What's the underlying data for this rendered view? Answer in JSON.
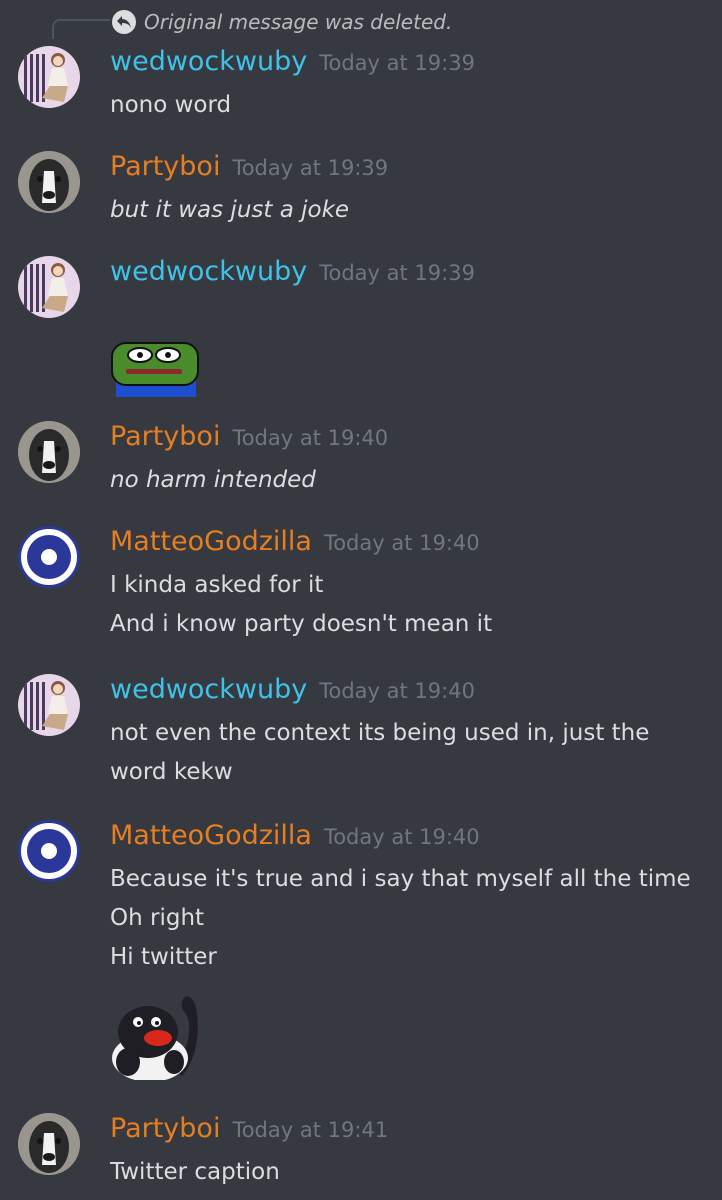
{
  "reply": {
    "text": "Original message was deleted.",
    "icon": "reply-arrow-icon"
  },
  "colors": {
    "background": "#36393f",
    "wedwockwuby": "#3fc2e8",
    "partyboi": "#e67e22",
    "matteogodzilla": "#e67e22",
    "timestamp": "#72767d"
  },
  "messages": [
    {
      "author": "wedwockwuby",
      "time": "Today at 19:39",
      "lines": [
        "nono word"
      ]
    },
    {
      "author": "Partyboi",
      "time": "Today at 19:39",
      "lines": [
        "but it was just a joke"
      ]
    },
    {
      "author": "wedwockwuby",
      "time": "Today at 19:39",
      "lines": [],
      "emoji": "pepe-emoji"
    },
    {
      "author": "Partyboi",
      "time": "Today at 19:40",
      "lines": [
        "no harm intended"
      ]
    },
    {
      "author": "MatteoGodzilla",
      "time": "Today at 19:40",
      "lines": [
        "I kinda asked for it",
        "And i know party doesn't mean it"
      ]
    },
    {
      "author": "wedwockwuby",
      "time": "Today at 19:40",
      "lines": [
        "not even the context its being used in, just the",
        "word kekw"
      ]
    },
    {
      "author": "MatteoGodzilla",
      "time": "Today at 19:40",
      "lines": [
        "Because it's true and i say that myself all the time",
        "Oh right",
        "Hi twitter"
      ],
      "emoji": "pingu-emoji"
    },
    {
      "author": "Partyboi",
      "time": "Today at 19:41",
      "lines": [
        "Twitter caption"
      ]
    }
  ]
}
